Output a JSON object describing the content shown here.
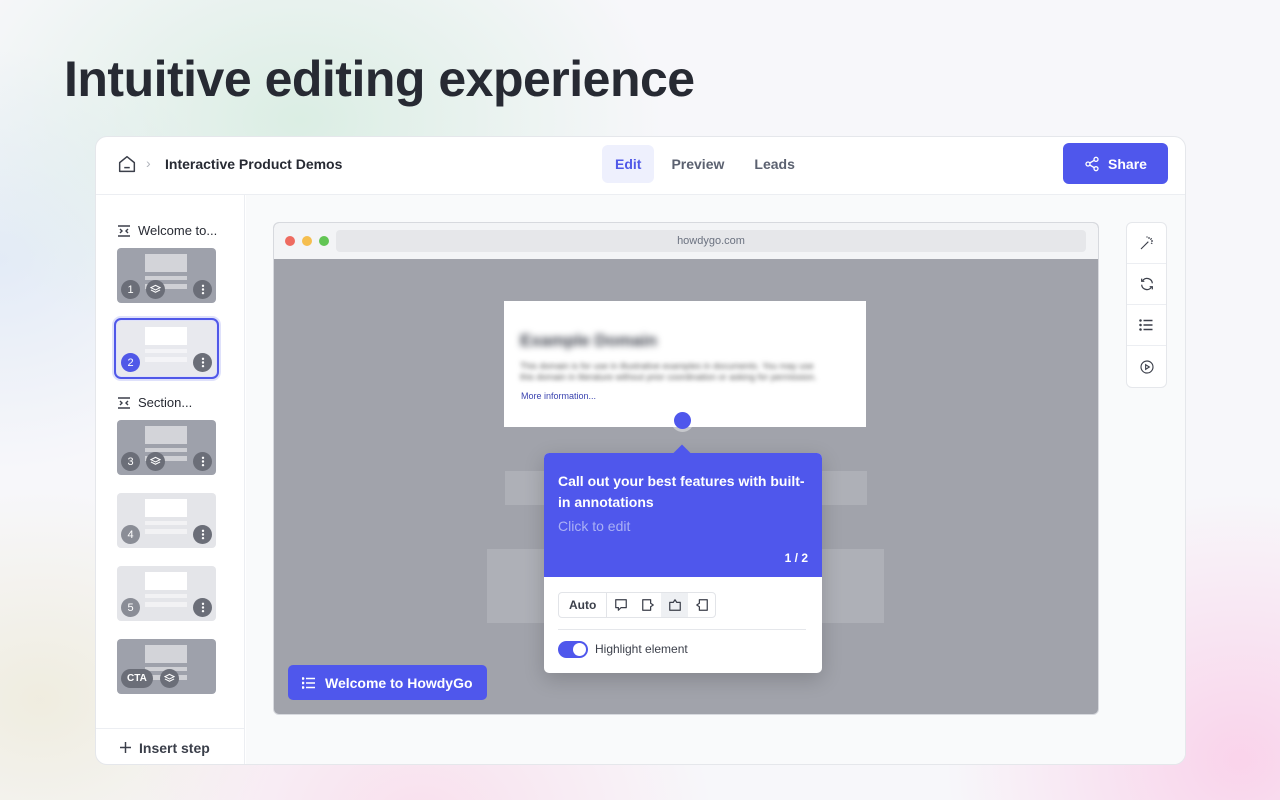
{
  "hero": {
    "title": "Intuitive editing experience"
  },
  "header": {
    "breadcrumb_sep": "›",
    "title": "Interactive Product Demos",
    "tabs": [
      {
        "label": "Edit",
        "active": true
      },
      {
        "label": "Preview",
        "active": false
      },
      {
        "label": "Leads",
        "active": false
      }
    ],
    "share_label": "Share"
  },
  "sidebar": {
    "sections": [
      "Welcome to...",
      "Section..."
    ],
    "steps": [
      {
        "badge": "1",
        "style": "dark"
      },
      {
        "badge": "2",
        "style": "selected"
      },
      {
        "badge": "3",
        "style": "dark"
      },
      {
        "badge": "4",
        "style": "light"
      },
      {
        "badge": "5",
        "style": "light"
      },
      {
        "badge": "CTA",
        "style": "dark"
      }
    ],
    "insert_label": "Insert step"
  },
  "browser": {
    "url": "howdygo.com",
    "page_title": "Example Domain",
    "page_text": "This domain is for use in illustrative examples in documents. You may use this domain in literature without prior coordination or asking for permission.",
    "more_link": "More information..."
  },
  "annotation": {
    "title": "Call out your best features with built-in annotations",
    "subtitle": "Click to edit",
    "page": "1 / 2",
    "position_auto": "Auto",
    "highlight_label": "Highlight element",
    "highlight_on": true
  },
  "chapter_button": "Welcome to HowdyGo",
  "colors": {
    "accent": "#4f57ec",
    "accent_light": "#eef0fd"
  },
  "tools": [
    "magic-wand-icon",
    "refresh-icon",
    "list-icon",
    "play-icon"
  ]
}
